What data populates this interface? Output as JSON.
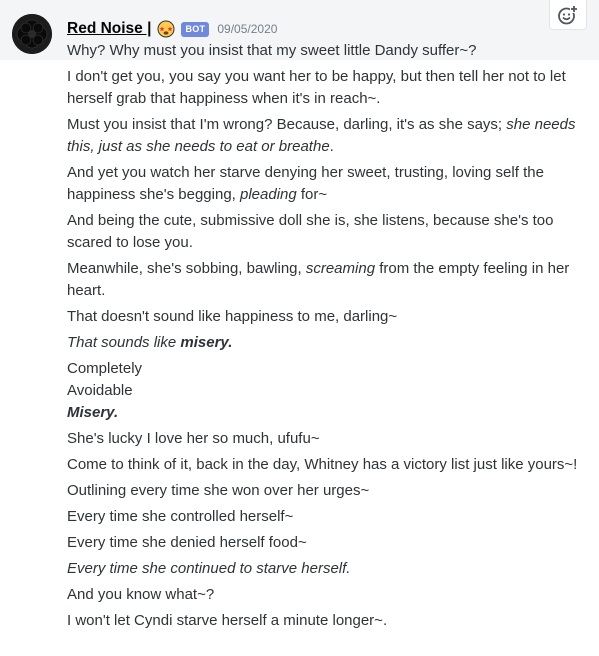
{
  "author": {
    "name": "Red Noise |",
    "bot_tag": "BOT",
    "timestamp": "09/05/2020",
    "avatar_icon": "black-flower-avatar",
    "emoji_icon": "star-struck-face-emoji"
  },
  "actions": {
    "react_icon": "add-reaction-icon"
  },
  "messages": [
    {
      "parts": [
        {
          "t": "Why? Why must you insist that my sweet little Dandy suffer~?"
        }
      ]
    },
    {
      "parts": [
        {
          "t": "I don't get you, you say you want her to be happy, but then tell her not to let herself grab that happiness when it's in reach~."
        }
      ]
    },
    {
      "parts": [
        {
          "t": "Must you insist that I'm wrong? Because, darling, it's as she says; "
        },
        {
          "t": "she needs this, just as she needs to eat or breathe",
          "i": true
        },
        {
          "t": "."
        }
      ]
    },
    {
      "parts": [
        {
          "t": "And yet you watch her starve denying her sweet, trusting, loving self the happiness she's begging, "
        },
        {
          "t": "pleading",
          "i": true
        },
        {
          "t": " for~"
        }
      ]
    },
    {
      "parts": [
        {
          "t": "And being the cute, submissive doll she is, she listens, because she's too scared to lose you."
        }
      ]
    },
    {
      "parts": [
        {
          "t": "Meanwhile, she's sobbing, bawling, "
        },
        {
          "t": "screaming",
          "i": true
        },
        {
          "t": " from the empty feeling in her heart."
        }
      ]
    },
    {
      "parts": [
        {
          "t": "That doesn't sound like happiness to me, darling~"
        }
      ]
    },
    {
      "parts": [
        {
          "t": "That sounds like ",
          "i": true
        },
        {
          "t": "misery.",
          "i": true,
          "b": true
        }
      ]
    },
    {
      "parts": [
        {
          "t": "Completely"
        }
      ],
      "tight_below": true
    },
    {
      "parts": [
        {
          "t": "Avoidable"
        }
      ],
      "tight_below": true
    },
    {
      "parts": [
        {
          "t": "Misery.",
          "i": true,
          "b": true
        }
      ]
    },
    {
      "parts": [
        {
          "t": "She's lucky I love her so much, ufufu~"
        }
      ]
    },
    {
      "parts": [
        {
          "t": "Come to think of it, back in the day, Whitney has a victory list just like yours~!"
        }
      ]
    },
    {
      "parts": [
        {
          "t": "Outlining every time she won over her urges~"
        }
      ]
    },
    {
      "parts": [
        {
          "t": "Every time she controlled herself~"
        }
      ]
    },
    {
      "parts": [
        {
          "t": "Every time she denied herself food~"
        }
      ]
    },
    {
      "parts": [
        {
          "t": "Every time she continued to starve herself.",
          "i": true
        }
      ]
    },
    {
      "parts": [
        {
          "t": "And you know what~?"
        }
      ]
    },
    {
      "parts": [
        {
          "t": "I won't let Cyndi starve herself a minute longer~."
        }
      ]
    }
  ]
}
